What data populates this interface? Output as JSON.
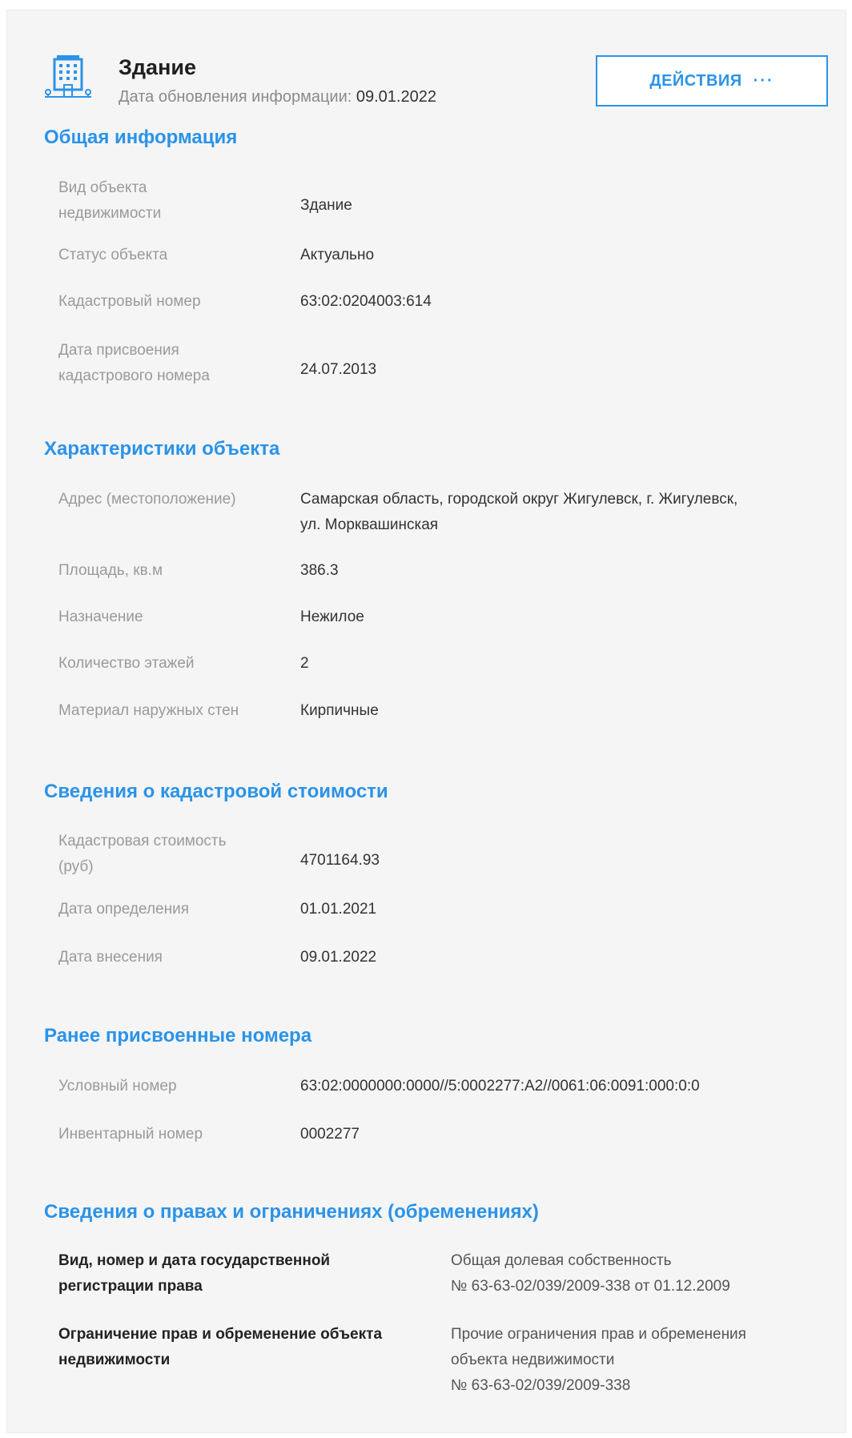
{
  "header": {
    "title": "Здание",
    "updated_label": "Дата обновления информации:",
    "updated_value": "09.01.2022",
    "actions_label": "ДЕЙСТВИЯ",
    "actions_dots": "···",
    "icon": "building-icon"
  },
  "general": {
    "title": "Общая информация",
    "rows": [
      {
        "label1": "Вид объекта",
        "label2": "недвижимости",
        "value": "Здание"
      },
      {
        "label1": "Статус объекта",
        "value": "Актуально"
      },
      {
        "label1": "Кадастровый номер",
        "value": "63:02:0204003:614"
      },
      {
        "label1": "Дата присвоения",
        "label2": "кадастрового номера",
        "value": "24.07.2013"
      }
    ]
  },
  "characteristics": {
    "title": "Характеристики объекта",
    "rows": [
      {
        "label1": "Адрес (местоположение)",
        "value1": "Самарская область, городской округ Жигулевск, г. Жигулевск,",
        "value2": "ул. Морквашинская"
      },
      {
        "label1": "Площадь, кв.м",
        "value1": "386.3"
      },
      {
        "label1": "Назначение",
        "value1": "Нежилое"
      },
      {
        "label1": "Количество этажей",
        "value1": "2"
      },
      {
        "label1": "Материал наружных стен",
        "value1": "Кирпичные"
      }
    ]
  },
  "cadastral_cost": {
    "title": "Сведения о кадастровой стоимости",
    "rows": [
      {
        "label1": "Кадастровая стоимость",
        "label2": "(руб)",
        "value": "4701164.93"
      },
      {
        "label1": "Дата определения",
        "value": "01.01.2021"
      },
      {
        "label1": "Дата внесения",
        "value": "09.01.2022"
      }
    ]
  },
  "previous_numbers": {
    "title": "Ранее присвоенные номера",
    "rows": [
      {
        "label1": "Условный номер",
        "value": "63:02:0000000:0000//5:0002277:А2//0061:06:0091:000:0:0"
      },
      {
        "label1": "Инвентарный номер",
        "value": "0002277"
      }
    ]
  },
  "rights": {
    "title": "Сведения о правах и ограничениях (обременениях)",
    "rows": [
      {
        "label1": "Вид, номер и дата государственной",
        "label2": "регистрации права",
        "value1": "Общая долевая собственность",
        "value2": "№ 63-63-02/039/2009-338 от 01.12.2009"
      },
      {
        "label1": "Ограничение прав и обременение объекта",
        "label2": "недвижимости",
        "value1": "Прочие ограничения прав и обременения",
        "value2": "объекта недвижимости",
        "value3": "№ 63-63-02/039/2009-338"
      }
    ]
  },
  "colors": {
    "accent": "#2b93e8",
    "panel": "#f5f5f5",
    "label": "#9a9a9a",
    "value": "#333333"
  }
}
